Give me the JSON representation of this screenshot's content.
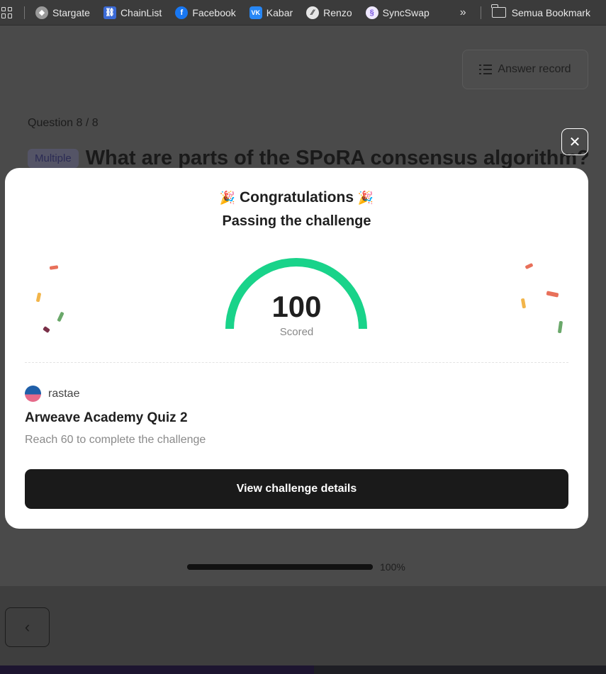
{
  "bookmarks": {
    "items": [
      {
        "label": "Stargate",
        "icon": "stargate-icon",
        "color": "#9a9a9a"
      },
      {
        "label": "ChainList",
        "icon": "chainlist-icon",
        "color": "#3b6ad6"
      },
      {
        "label": "Facebook",
        "icon": "facebook-icon",
        "color": "#1877f2"
      },
      {
        "label": "Kabar",
        "icon": "vk-icon",
        "color": "#2787f5"
      },
      {
        "label": "Renzo",
        "icon": "renzo-icon",
        "color": "#e6e6e6"
      },
      {
        "label": "SyncSwap",
        "icon": "syncswap-icon",
        "color": "#a88bf0"
      }
    ],
    "more": "»",
    "folder_label": "Semua Bookmark"
  },
  "page": {
    "answer_record": "Answer record",
    "question_counter": "Question 8 / 8",
    "question_badge": "Multiple",
    "question_title": "What are parts of the SPoRA consensus algorithm?",
    "progress_percent": 100,
    "progress_label": "100%",
    "back_symbol": "‹"
  },
  "modal": {
    "close_symbol": "✕",
    "party_emoji": "🎉",
    "title": "Congratulations",
    "subtitle": "Passing the challenge",
    "score": "100",
    "score_label": "Scored",
    "gauge_fraction": 1.0,
    "gauge_color": "#19d38a",
    "username": "rastae",
    "quiz_title": "Arweave Academy Quiz 2",
    "quiz_desc": "Reach 60 to complete the challenge",
    "button_label": "View challenge details"
  }
}
